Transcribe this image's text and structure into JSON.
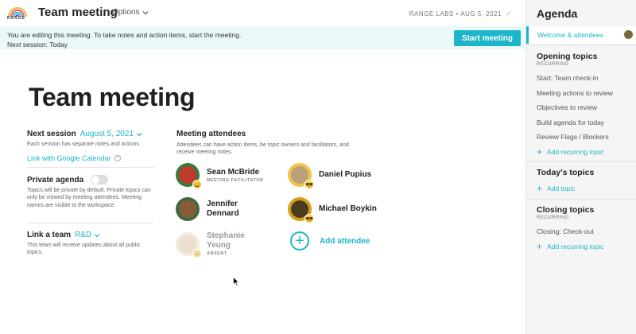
{
  "app": {
    "logo_text": "RANGE",
    "title": "Team meeting",
    "options_label": "Options",
    "meta": "RANGE LABS • AUG 5, 2021"
  },
  "banner": {
    "line1": "You are editing this meeting. To take notes and action items, start the meeting.",
    "line2": "Next session: Today",
    "start_button": "Start meeting"
  },
  "main": {
    "title": "Team meeting",
    "next_session": {
      "label": "Next session",
      "value": "August 5, 2021",
      "description": "Each session has separate notes and actions.",
      "calendar_link": "Link with Google Calendar",
      "help": "?"
    },
    "private_agenda": {
      "label": "Private agenda",
      "enabled": false,
      "description": "Topics will be private by default. Private topics can only be viewed by meeting attendees. Meeting names are visible to the workspace."
    },
    "link_team": {
      "label": "Link a team",
      "value": "R&D",
      "description": "This team will receive updates about all public topics."
    }
  },
  "attendees": {
    "heading": "Meeting attendees",
    "description": "Attendees can have action items, be topic owners and facilitators, and receive meeting notes.",
    "people": [
      {
        "name": "Sean McBride",
        "role": "MEETING FACILITATOR",
        "emoji": "😀",
        "color": "#c0392b"
      },
      {
        "name": "Daniel Pupius",
        "role": "",
        "emoji": "😎",
        "color": "#b7a27a"
      },
      {
        "name": "Jennifer Dennard",
        "role": "",
        "emoji": "",
        "color": "#8a5a3c"
      },
      {
        "name": "Michael Boykin",
        "role": "",
        "emoji": "😎",
        "color": "#4a3a20"
      },
      {
        "name": "Stephanie Yeung",
        "role": "ABSENT",
        "emoji": "😀",
        "color": "#d9c2a3"
      }
    ],
    "add_label": "Add attendee",
    "add_symbol": "+"
  },
  "agenda": {
    "title": "Agenda",
    "selected": "Welcome & attendees",
    "opening": {
      "title": "Opening topics",
      "sub": "RECURRING",
      "items": [
        "Start: Team check-in",
        "Meeting actions to review",
        "Objectives to review",
        "Build agenda for today",
        "Review Flags / Blockers"
      ],
      "add": "Add recurring topic"
    },
    "today": {
      "title": "Today's topics",
      "add": "Add topic"
    },
    "closing": {
      "title": "Closing topics",
      "sub": "RECURRING",
      "items": [
        "Closing: Check-out"
      ],
      "add": "Add recurring topic"
    },
    "plus_symbol": "+"
  },
  "colors": {
    "accent": "#1cb5c9",
    "banner_bg": "#eaf8fa",
    "sidebar_bg": "#f5f5f5"
  }
}
